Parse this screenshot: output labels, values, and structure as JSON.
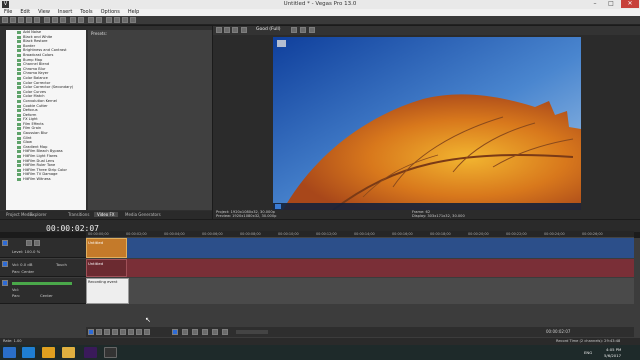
{
  "app": {
    "title": "Untitled * - Vegas Pro 13.0",
    "icon_label": "V"
  },
  "window_controls": [
    "–",
    "□",
    "✕"
  ],
  "menu": [
    "File",
    "Edit",
    "View",
    "Insert",
    "Tools",
    "Options",
    "Help"
  ],
  "effects_list": [
    "Add Noise",
    "Black and White",
    "Black Restore",
    "Border",
    "Brightness and Contrast",
    "Broadcast Colors",
    "Bump Map",
    "Channel Blend",
    "Chroma Blur",
    "Chroma Keyer",
    "Color Balance",
    "Color Corrector",
    "Color Corrector (Secondary)",
    "Color Curves",
    "Color Match",
    "Convolution Kernel",
    "Cookie Cutter",
    "Defocus",
    "Deform",
    "FX Light",
    "Film Effects",
    "Film Grain",
    "Gaussian Blur",
    "Glint",
    "Glow",
    "Gradient Map",
    "HitFilm Bleach Bypass",
    "HitFilm Light Flares",
    "HitFilm Dual Lens",
    "HitFilm Ruler Tone",
    "HitFilm Three Strip Color",
    "HitFilm TV Damage",
    "HitFilm Witness"
  ],
  "presets_label": "Presets:",
  "left_tabs": [
    "Project Media",
    "Explorer",
    "Transitions",
    "Video FX",
    "Media Generators"
  ],
  "left_active_tab": "Video FX",
  "preview": {
    "quality": "Good (Full)",
    "info_line1": "Project:  1920x1080x32, 30.000p",
    "info_line2": "Preview:  1920x1080x32, 30.000p",
    "frame_line1": "Frame:   62",
    "frame_line2": "Display:  303x171x32, 30.000"
  },
  "timeline": {
    "timecode": "00:00:02:07",
    "ruler_marks": [
      "00:00:00;00",
      "00:00:02;00",
      "00:00:04;00",
      "00:00:06;00",
      "00:00:08;00",
      "00:00:10;00",
      "00:00:12;00",
      "00:00:14;00",
      "00:00:16;00",
      "00:00:18;00",
      "00:00:20;00",
      "00:00:22;00",
      "00:00:24;00",
      "00:00:26;00"
    ],
    "track1_level": "Level: 100.0 %",
    "track2_label": "Vol:  0.0 dB",
    "track2_pan": "Pan:   Center",
    "track2_touch": "Touch",
    "track3_vol": "Vol:",
    "track3_pan": "Pan:",
    "track3_center": "Center",
    "clip1": "Untitled",
    "clip2": "Untitled",
    "clip3": "Recording event"
  },
  "status": {
    "rate": "Rate: 1.00",
    "record": "Record Time (2 channels): 29:43:48",
    "pos": "00:00:02:07"
  },
  "tray": {
    "lang": "ENG",
    "time": "4:05 PM",
    "date": "5/6/2017"
  },
  "colors": {
    "accent_blue": "#2e6bd6",
    "audio_track": "#7a2f37",
    "video_track": "#2c4f8a",
    "taskbar": "#1e2a2a"
  }
}
